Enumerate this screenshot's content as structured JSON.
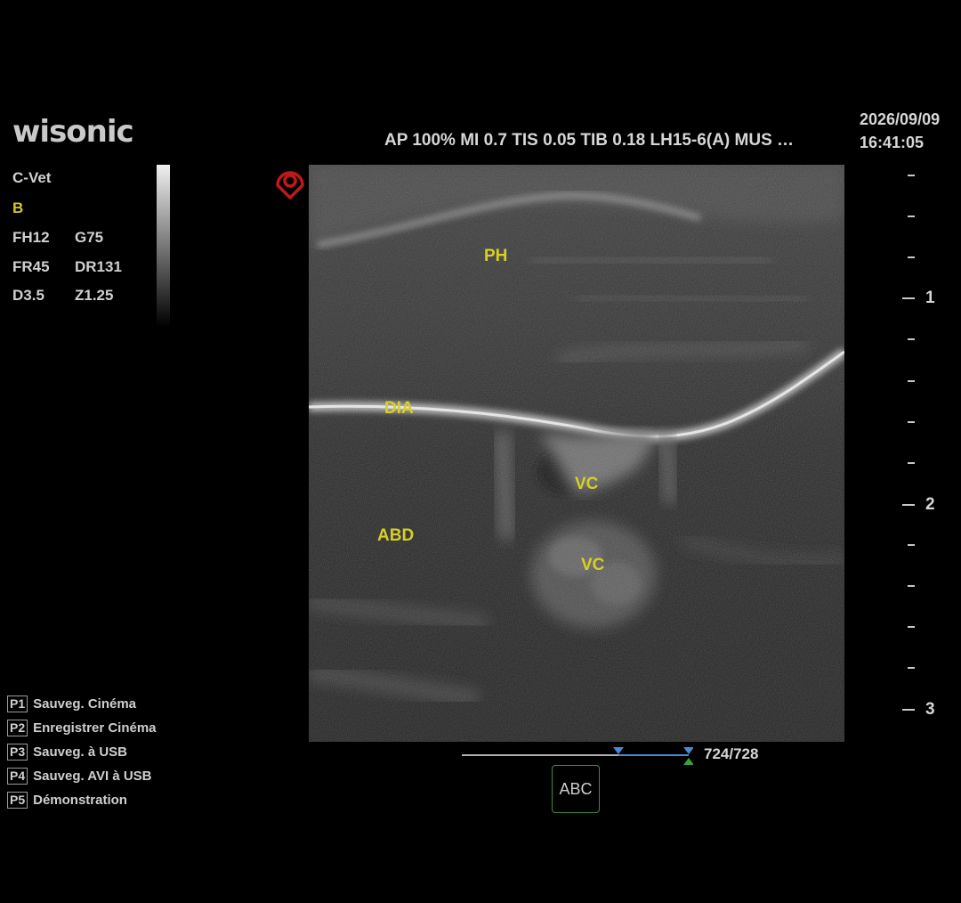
{
  "brand": {
    "logo": "wisonic"
  },
  "header": {
    "params": "AP 100% MI 0.7 TIS 0.05  TIB 0.18  LH15-6(A)  MUS …",
    "date": "2026/09/09",
    "time": "16:41:05"
  },
  "left_panel": {
    "preset": "C-Vet",
    "mode": "B",
    "params": [
      {
        "a": "FH12",
        "b": "G75"
      },
      {
        "a": "FR45",
        "b": "DR131"
      },
      {
        "a": "D3.5",
        "b": "Z1.25"
      }
    ]
  },
  "annotations": {
    "ph": "PH",
    "dia": "DIA",
    "vc1": "VC",
    "abd": "ABD",
    "vc2": "VC"
  },
  "depth_scale": {
    "labels": [
      "1",
      "2",
      "3"
    ]
  },
  "presets": [
    {
      "key": "P1",
      "label": "Sauveg. Cinéma"
    },
    {
      "key": "P2",
      "label": "Enregistrer Cinéma"
    },
    {
      "key": "P3",
      "label": "Sauveg. à USB"
    },
    {
      "key": "P4",
      "label": "Sauveg. AVI à USB"
    },
    {
      "key": "P5",
      "label": "Démonstration"
    }
  ],
  "cine": {
    "frame_counter": "724/728",
    "progress": 0.9945
  },
  "abc_button": {
    "label": "ABC"
  },
  "colors": {
    "annotation": "#d8cf24",
    "mode": "#d4c62a",
    "probe_mark": "#c0191c",
    "cine_marker": "#4a8ad0",
    "cine_end": "#3aa03a"
  }
}
